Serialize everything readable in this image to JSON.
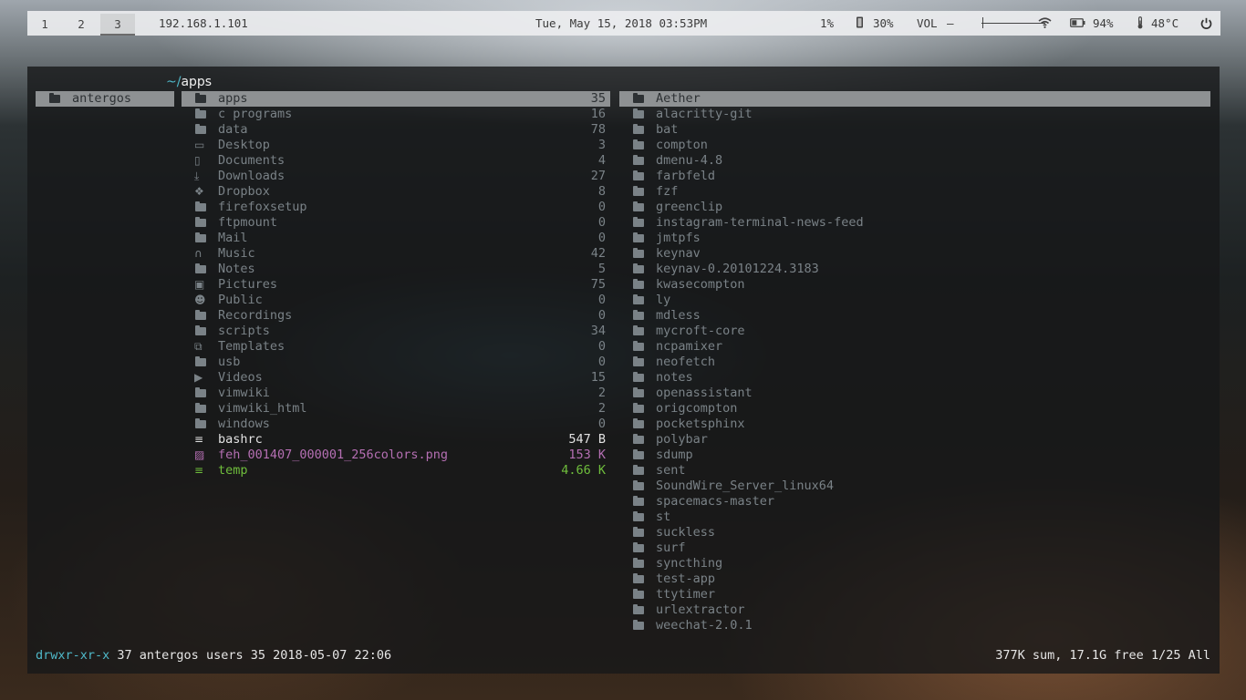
{
  "topbar": {
    "workspaces": [
      "1",
      "2",
      "3"
    ],
    "active_workspace": "3",
    "ip": "192.168.1.101",
    "datetime": "Tue, May 15, 2018 03:53PM",
    "cpu": "1%",
    "memory": "30%",
    "volume_label": "VOL",
    "volume_level": 0.02,
    "battery": "94%",
    "temperature": "48°C"
  },
  "file_manager": {
    "path_home": "~/",
    "path_dir": "apps",
    "parent_column": [
      {
        "name": "antergos",
        "icon": "folder-icon"
      }
    ],
    "current_column": [
      {
        "name": "apps",
        "size": "35",
        "icon": "folder-icon",
        "kind": "dir",
        "selected": true
      },
      {
        "name": "c programs",
        "size": "16",
        "icon": "folder-icon",
        "kind": "dir"
      },
      {
        "name": "data",
        "size": "78",
        "icon": "folder-icon",
        "kind": "dir"
      },
      {
        "name": "Desktop",
        "size": "3",
        "icon": "desktop-icon",
        "kind": "dir"
      },
      {
        "name": "Documents",
        "size": "4",
        "icon": "documents-icon",
        "kind": "dir"
      },
      {
        "name": "Downloads",
        "size": "27",
        "icon": "download-icon",
        "kind": "dir"
      },
      {
        "name": "Dropbox",
        "size": "8",
        "icon": "dropbox-icon",
        "kind": "dir"
      },
      {
        "name": "firefoxsetup",
        "size": "0",
        "icon": "folder-icon",
        "kind": "dir"
      },
      {
        "name": "ftpmount",
        "size": "0",
        "icon": "folder-icon",
        "kind": "dir"
      },
      {
        "name": "Mail",
        "size": "0",
        "icon": "folder-icon",
        "kind": "dir"
      },
      {
        "name": "Music",
        "size": "42",
        "icon": "headphones-icon",
        "kind": "dir"
      },
      {
        "name": "Notes",
        "size": "5",
        "icon": "folder-icon",
        "kind": "dir"
      },
      {
        "name": "Pictures",
        "size": "75",
        "icon": "pictures-icon",
        "kind": "dir"
      },
      {
        "name": "Public",
        "size": "0",
        "icon": "users-icon",
        "kind": "dir"
      },
      {
        "name": "Recordings",
        "size": "0",
        "icon": "folder-icon",
        "kind": "dir"
      },
      {
        "name": "scripts",
        "size": "34",
        "icon": "folder-icon",
        "kind": "dir"
      },
      {
        "name": "Templates",
        "size": "0",
        "icon": "templates-icon",
        "kind": "dir"
      },
      {
        "name": "usb",
        "size": "0",
        "icon": "folder-icon",
        "kind": "dir"
      },
      {
        "name": "Videos",
        "size": "15",
        "icon": "video-icon",
        "kind": "dir"
      },
      {
        "name": "vimwiki",
        "size": "2",
        "icon": "folder-icon",
        "kind": "dir"
      },
      {
        "name": "vimwiki_html",
        "size": "2",
        "icon": "folder-icon",
        "kind": "dir"
      },
      {
        "name": "windows",
        "size": "0",
        "icon": "folder-icon",
        "kind": "dir"
      },
      {
        "name": "bashrc",
        "size": "547 B",
        "icon": "text-file-icon",
        "kind": "file-plain"
      },
      {
        "name": "feh_001407_000001_256colors.png",
        "size": "153 K",
        "icon": "image-file-icon",
        "kind": "file-img"
      },
      {
        "name": "temp",
        "size": "4.66 K",
        "icon": "text-file-icon",
        "kind": "file-exec"
      }
    ],
    "preview_column": [
      {
        "name": "Aether",
        "selected": true
      },
      {
        "name": "alacritty-git"
      },
      {
        "name": "bat"
      },
      {
        "name": "compton"
      },
      {
        "name": "dmenu-4.8"
      },
      {
        "name": "farbfeld"
      },
      {
        "name": "fzf"
      },
      {
        "name": "greenclip"
      },
      {
        "name": "instagram-terminal-news-feed"
      },
      {
        "name": "jmtpfs"
      },
      {
        "name": "keynav"
      },
      {
        "name": "keynav-0.20101224.3183"
      },
      {
        "name": "kwasecompton"
      },
      {
        "name": "ly"
      },
      {
        "name": "mdless"
      },
      {
        "name": "mycroft-core"
      },
      {
        "name": "ncpamixer"
      },
      {
        "name": "neofetch"
      },
      {
        "name": "notes"
      },
      {
        "name": "openassistant"
      },
      {
        "name": "origcompton"
      },
      {
        "name": "pocketsphinx"
      },
      {
        "name": "polybar"
      },
      {
        "name": "sdump"
      },
      {
        "name": "sent"
      },
      {
        "name": "SoundWire_Server_linux64"
      },
      {
        "name": "spacemacs-master"
      },
      {
        "name": "st"
      },
      {
        "name": "suckless"
      },
      {
        "name": "surf"
      },
      {
        "name": "syncthing"
      },
      {
        "name": "test-app"
      },
      {
        "name": "ttytimer"
      },
      {
        "name": "urlextractor"
      },
      {
        "name": "weechat-2.0.1"
      }
    ],
    "status": {
      "permissions": "drwxr-xr-x",
      "info": " 37 antergos users 35 2018-05-07 22:06",
      "disk": "377K sum, 17.1G free",
      "position": "1/25",
      "scroll": "All"
    }
  },
  "colors": {
    "dir": "#7a8287",
    "selection": "#8e9193",
    "image_file": "#b56fb3",
    "exec_file": "#6fbe3c",
    "accent": "#4fb9c9"
  }
}
